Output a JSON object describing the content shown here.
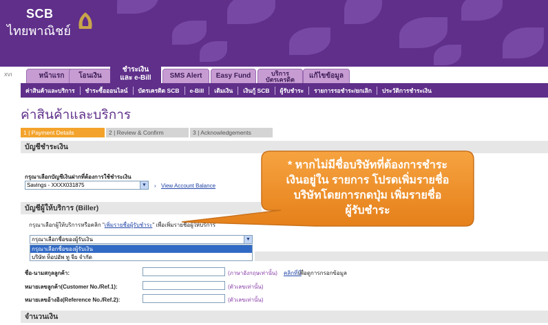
{
  "header": {
    "brand_en": "SCB",
    "brand_th": "ไทยพาณิชย์",
    "version": "XVI"
  },
  "tabs": [
    {
      "label": "หน้าแรก"
    },
    {
      "label": "โอนเงิน"
    },
    {
      "label1": "ชำระเงิน",
      "label2": "และ e-Bill",
      "active": true
    },
    {
      "label": "SMS Alert"
    },
    {
      "label": "Easy Fund"
    },
    {
      "label1": "บริการ",
      "label2": "บัตรเครดิต"
    },
    {
      "label": "แก้ไขข้อมูล"
    }
  ],
  "subnav": [
    "ค่าสินค้าและบริการ",
    "ชำระซื้อออนไลน์",
    "บัตรเครดิต SCB",
    "e-Bill",
    "เติมเงิน",
    "เงินกู้ SCB",
    "ผู้รับชำระ",
    "รายการรอชำระ/ยกเลิก",
    "ประวัติการชำระเงิน"
  ],
  "page_title": "ค่าสินค้าและบริการ",
  "steps": {
    "s1": "1 | Payment Details",
    "s2": "2 | Review & Confirm",
    "s3": "3 | Acknowledgements"
  },
  "account_section": {
    "title": "บัญชีชำระเงิน",
    "prompt": "กรุณาเลือกบัญชีเงินฝากที่ต้องการใช้ชำระเงิน",
    "selected_account": "Savings - XXXX031875",
    "view_balance": "View Account Balance"
  },
  "biller_section": {
    "title": "บัญชีผู้ให้บริการ (Biller)",
    "prompt_before": "กรุณาเลือกผู้ให้บริการหรือคลิก \"",
    "prompt_link": "เพิ่มรายชื่อผู้รับชำระ",
    "prompt_after": "\" เพื่อเพิ่มรายชื่อผู้ให้บริการ",
    "select_value": "กรุณาเลือกชื่อของผู้รับเงิน",
    "options": [
      "กรุณาเลือกชื่อของผู้รับเงิน",
      "บริษัท ท็อปอัพ ทู จีย จำกัด"
    ]
  },
  "fields": {
    "name_label": "ชื่อ-นามสกุลลูกค้า:",
    "name_hint": "(ภาษาอังกฤษเท่านั้น)",
    "click_here": "คลิกที่นี่",
    "click_here_after": " เพื่อดูการกรอกข้อมูล",
    "ref1_label": "หมายเลขลูกค้า(Customer No./Ref.1):",
    "ref1_hint": "(ตัวเลขเท่านั้น)",
    "ref2_label": "หมายเลขอ้างอิง(Reference No./Ref.2):",
    "ref2_hint": "(ตัวเลขเท่านั้น)"
  },
  "amount_section": {
    "title": "จำนวนเงิน"
  },
  "callout": {
    "line1": "* หากไม่มีชื่อบริษัทที่ต้องการชำระ",
    "line2": "เงินอยู่ใน รายการ โปรดเพิ่มรายชื่อ",
    "line3": "บริษัทโดยการกดปุ่ม เพิ่มรายชื่อ",
    "line4": "ผู้รับชำระ"
  },
  "colors": {
    "brand_purple": "#5f2f8a",
    "callout_orange": "#ef9120",
    "step_active": "#f3a32b",
    "link_blue": "#1f43a6"
  }
}
